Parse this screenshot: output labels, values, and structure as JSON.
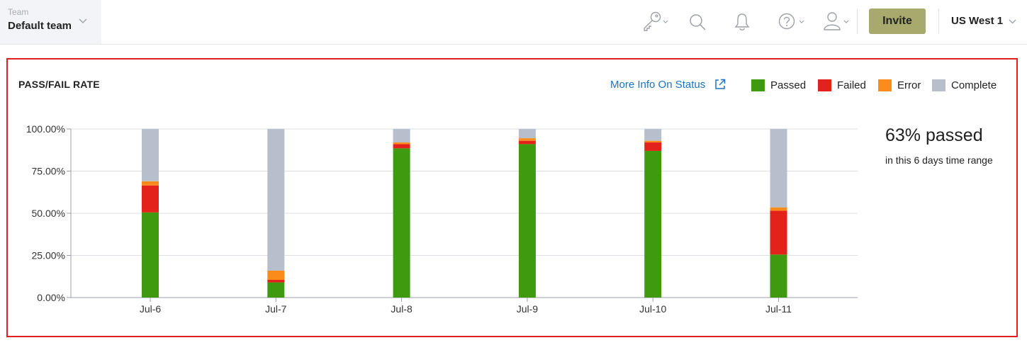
{
  "header": {
    "team_label": "Team",
    "team_value": "Default team",
    "invite_label": "Invite",
    "region_label": "US West 1",
    "icons": [
      "key-icon",
      "search-icon",
      "bell-icon",
      "help-icon",
      "user-icon"
    ]
  },
  "card": {
    "title": "PASS/FAIL RATE",
    "more_info_label": "More Info On Status",
    "legend": [
      {
        "name": "Passed",
        "color": "#3f9a10"
      },
      {
        "name": "Failed",
        "color": "#e3231b"
      },
      {
        "name": "Error",
        "color": "#fb8c1c"
      },
      {
        "name": "Complete",
        "color": "#b8bfcc"
      }
    ],
    "summary_value": "63% passed",
    "summary_caption": "in this 6 days time range"
  },
  "chart_data": {
    "type": "bar",
    "stacked": true,
    "categories": [
      "Jul-6",
      "Jul-7",
      "Jul-8",
      "Jul-9",
      "Jul-10",
      "Jul-11"
    ],
    "series": [
      {
        "name": "Passed",
        "color": "#3f9a10",
        "values": [
          50.5,
          9,
          88.5,
          91,
          87,
          25.5
        ]
      },
      {
        "name": "Failed",
        "color": "#e3231b",
        "values": [
          16,
          1.5,
          2.5,
          2,
          5,
          26
        ]
      },
      {
        "name": "Error",
        "color": "#fb8c1c",
        "values": [
          2.5,
          5.5,
          1,
          1.5,
          1,
          2
        ]
      },
      {
        "name": "Complete",
        "color": "#b8bfcc",
        "values": [
          31,
          84,
          8,
          5.5,
          7,
          46.5
        ]
      }
    ],
    "y_ticks": [
      "0.00%",
      "25.00%",
      "50.00%",
      "75.00%",
      "100.00%"
    ],
    "ylim": [
      0,
      100
    ],
    "grid": true,
    "legend_position": "top-right"
  }
}
